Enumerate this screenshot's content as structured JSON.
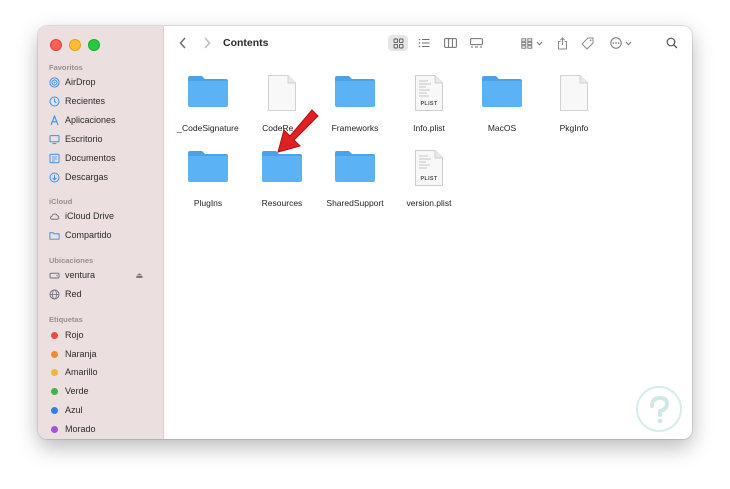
{
  "window": {
    "title": "Contents"
  },
  "sidebar": {
    "sections": [
      {
        "title": "Favoritos",
        "items": [
          {
            "label": "AirDrop",
            "icon": "airdrop-icon"
          },
          {
            "label": "Recientes",
            "icon": "clock-icon"
          },
          {
            "label": "Aplicaciones",
            "icon": "apps-icon"
          },
          {
            "label": "Escritorio",
            "icon": "desktop-icon"
          },
          {
            "label": "Documentos",
            "icon": "document-icon"
          },
          {
            "label": "Descargas",
            "icon": "download-icon"
          }
        ]
      },
      {
        "title": "iCloud",
        "items": [
          {
            "label": "iCloud Drive",
            "icon": "cloud-icon"
          },
          {
            "label": "Compartido",
            "icon": "shared-folder-icon"
          }
        ]
      },
      {
        "title": "Ubicaciones",
        "items": [
          {
            "label": "ventura",
            "icon": "disk-icon"
          },
          {
            "label": "Red",
            "icon": "network-icon"
          }
        ]
      },
      {
        "title": "Etiquetas",
        "tags": [
          {
            "label": "Rojo",
            "color": "#ee4b44"
          },
          {
            "label": "Naranja",
            "color": "#f08a33"
          },
          {
            "label": "Amarillo",
            "color": "#f2b43c"
          },
          {
            "label": "Verde",
            "color": "#3fb34a"
          },
          {
            "label": "Azul",
            "color": "#2f80ea"
          },
          {
            "label": "Morado",
            "color": "#a055d8"
          }
        ]
      }
    ]
  },
  "files": [
    {
      "name": "_CodeSignature",
      "kind": "folder"
    },
    {
      "name": "CodeRe…",
      "kind": "document"
    },
    {
      "name": "Frameworks",
      "kind": "folder"
    },
    {
      "name": "Info.plist",
      "kind": "plist",
      "badge": "PLIST"
    },
    {
      "name": "MacOS",
      "kind": "folder"
    },
    {
      "name": "PkgInfo",
      "kind": "document"
    },
    {
      "name": "PlugIns",
      "kind": "folder"
    },
    {
      "name": "Resources",
      "kind": "folder"
    },
    {
      "name": "SharedSupport",
      "kind": "folder"
    },
    {
      "name": "version.plist",
      "kind": "plist",
      "badge": "PLIST"
    }
  ],
  "colors": {
    "folder": "#5bb2f4",
    "folder_tab": "#4aa3e8",
    "sidebar_bg": "#ecdfe0",
    "arrow": "#e02121"
  }
}
